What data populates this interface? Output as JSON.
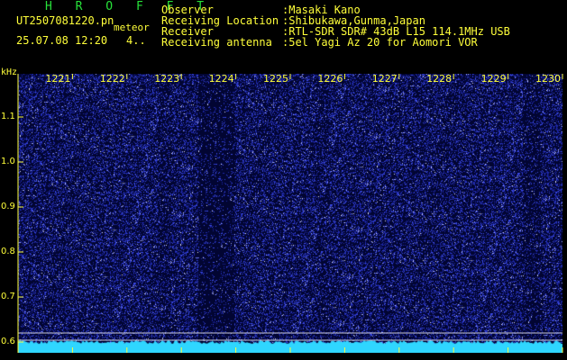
{
  "header": {
    "brand": "H R O F F T",
    "file": "UT2507081220.pn",
    "tag": "meteor",
    "date": "25.07.08 12:20",
    "count": "4..",
    "info": [
      {
        "label": "Observer",
        "value": ":Masaki Kano"
      },
      {
        "label": "Receiving Location",
        "value": ":Shibukawa,Gunma,Japan"
      },
      {
        "label": "Receiver",
        "value": ":RTL-SDR SDR# 43dB L15 114.1MHz USB"
      },
      {
        "label": "Receiving antenna",
        "value": ":5el Yagi Az 20 for Aomori VOR"
      }
    ]
  },
  "axes": {
    "y_unit": "kHz",
    "y_ticks": [
      {
        "label": "1.1",
        "value": 1.1
      },
      {
        "label": "1.0",
        "value": 1.0
      },
      {
        "label": "0.9",
        "value": 0.9
      },
      {
        "label": "0.8",
        "value": 0.8
      },
      {
        "label": "0.7",
        "value": 0.7
      },
      {
        "label": "0.6",
        "value": 0.6
      }
    ],
    "x_ticks": [
      {
        "label": "1221",
        "value": 1221
      },
      {
        "label": "1222",
        "value": 1222
      },
      {
        "label": "1223",
        "value": 1223
      },
      {
        "label": "1224",
        "value": 1224
      },
      {
        "label": "1225",
        "value": 1225
      },
      {
        "label": "1226",
        "value": 1226
      },
      {
        "label": "1227",
        "value": 1227
      },
      {
        "label": "1228",
        "value": 1228
      },
      {
        "label": "1229",
        "value": 1229
      },
      {
        "label": "1230",
        "value": 1230
      }
    ],
    "x_range": [
      1220,
      1230
    ],
    "y_range": [
      0.576,
      1.196
    ]
  },
  "colors": {
    "text": "#ffff3a",
    "brand": "#27e23a",
    "background": "#02053c",
    "noise": "#3a46ff",
    "spectrum_line": "#2fd6ff"
  }
}
